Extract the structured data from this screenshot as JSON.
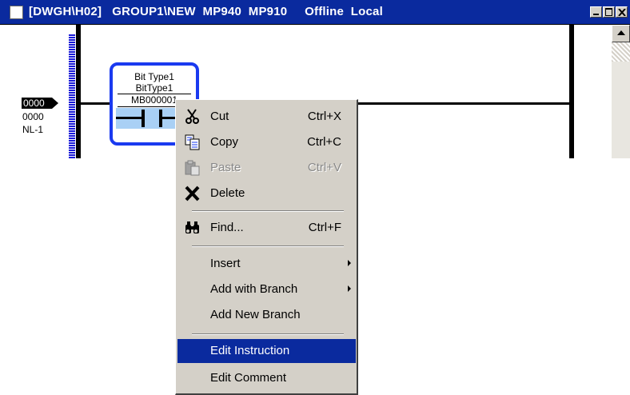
{
  "window": {
    "title": "[DWGH\\H02]   GROUP1\\NEW  MP940  MP910     Offline  Local"
  },
  "rung": {
    "tag": "0000",
    "number": "0000",
    "label": "NL-1"
  },
  "instruction": {
    "line1": "Bit Type1",
    "line2": "BitType1",
    "line3": "MB000001"
  },
  "context_menu": {
    "items": [
      {
        "label": "Cut",
        "shortcut": "Ctrl+X",
        "icon": "scissors-icon",
        "enabled": true
      },
      {
        "label": "Copy",
        "shortcut": "Ctrl+C",
        "icon": "copy-icon",
        "enabled": true
      },
      {
        "label": "Paste",
        "shortcut": "Ctrl+V",
        "icon": "paste-icon",
        "enabled": false
      },
      {
        "label": "Delete",
        "shortcut": "",
        "icon": "delete-x-icon",
        "enabled": true
      },
      {
        "label": "Find...",
        "shortcut": "Ctrl+F",
        "icon": "binoculars-icon",
        "enabled": true
      },
      {
        "label": "Insert",
        "shortcut": "",
        "submenu": true,
        "enabled": true
      },
      {
        "label": "Add with Branch",
        "shortcut": "",
        "submenu": true,
        "enabled": true
      },
      {
        "label": "Add New Branch",
        "shortcut": "",
        "enabled": true
      },
      {
        "label": "Edit Instruction",
        "shortcut": "",
        "enabled": true,
        "selected": true
      },
      {
        "label": "Edit Comment",
        "shortcut": "",
        "enabled": true
      }
    ]
  },
  "colors": {
    "titlebar": "#0a2a9e",
    "selection": "#0a2a9e",
    "instruction_border": "#1a3af0",
    "contact_highlight": "#a9d0f5",
    "menu_bg": "#d4d0c8"
  }
}
